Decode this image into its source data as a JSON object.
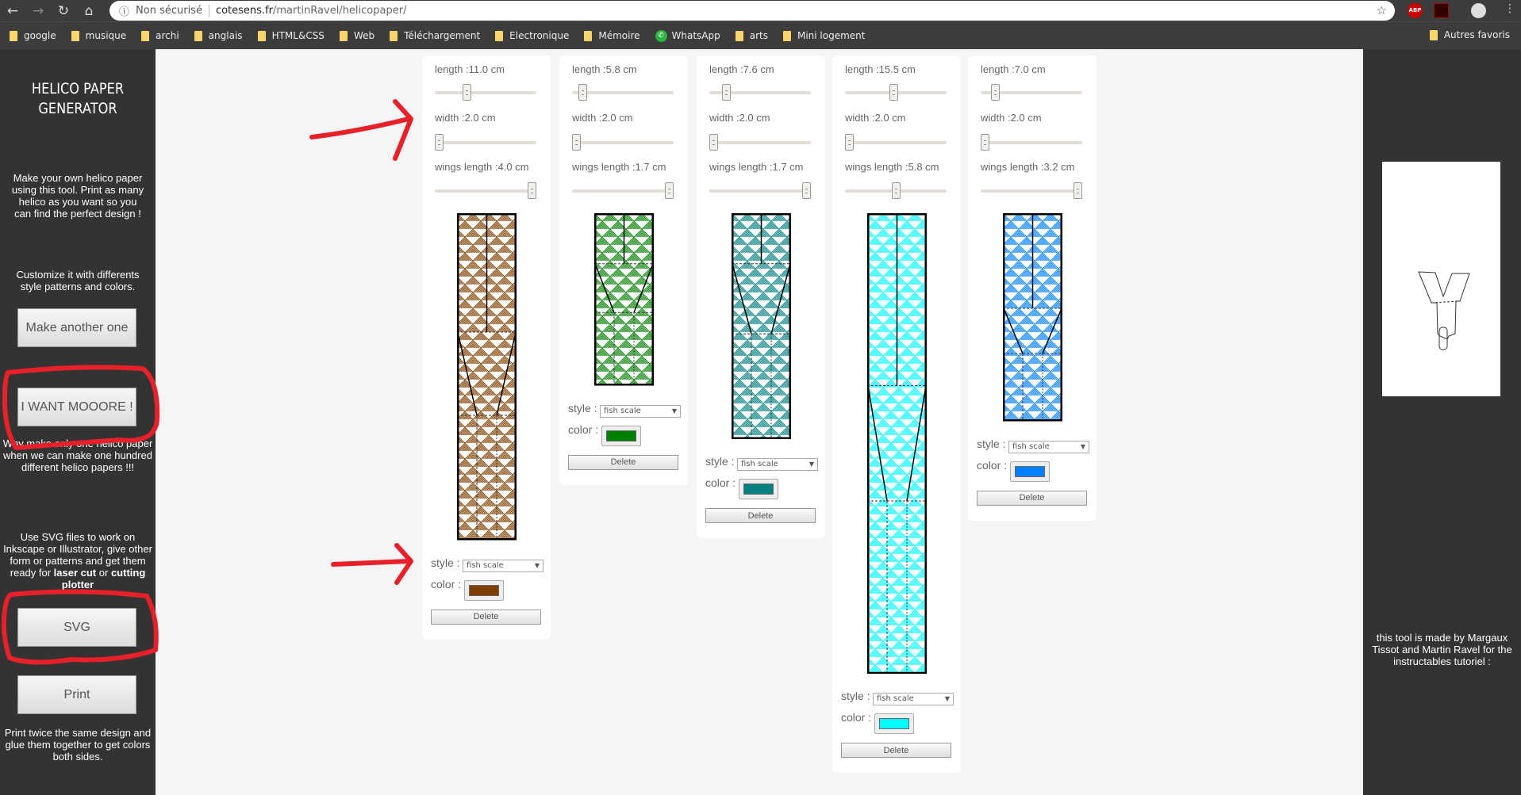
{
  "browser": {
    "security": "Non sécurisé",
    "url_host": "cotesens.fr",
    "url_path": "/martinRavel/helicopaper/",
    "bookmarks": [
      "google",
      "musique",
      "archi",
      "anglais",
      "HTML&CSS",
      "Web",
      "Téléchargement",
      "Electronique",
      "Mémoire",
      "WhatsApp",
      "arts",
      "Mini logement"
    ],
    "other_bookmarks": "Autres favoris",
    "ext_abp": "ABP"
  },
  "sidebar": {
    "title": "HELICO PAPER GENERATOR",
    "intro": "Make your own helico paper using this tool. Print as many helico as you want so you can find the perfect design !",
    "customize": "Customize it with differents style patterns and colors.",
    "make_another": "Make another one",
    "want_more": "I WANT MOOORE !",
    "more_text": "Why make only one helico paper when we can make one hundred different helico papers !!!",
    "svg_text_1": "Use SVG files to work on Inkscape or Illustrator, give other form or patterns and get them ready for ",
    "svg_bold_1": "laser cut",
    "svg_text_2": " or ",
    "svg_bold_2": "cutting plotter",
    "svg_button": "SVG",
    "print_button": "Print",
    "print_text": "Print twice the same design and glue them together to get colors both sides."
  },
  "right_panel": {
    "credit": "this tool is made by Margaux Tissot and Martin Ravel for the instructables tutoriel :"
  },
  "cards": [
    {
      "length_label": "length :11.0 cm",
      "width_label": "width :2.0 cm",
      "wings_label": "wings length :4.0 cm",
      "length": 11.0,
      "width": 2.0,
      "wings": 4.0,
      "length_slider": 0.3,
      "width_slider": 0,
      "wings_slider": 1,
      "style_label": "style :",
      "style": "fish scale",
      "color_label": "color :",
      "color": "#7f3f00",
      "delete": "Delete"
    },
    {
      "length_label": "length :5.8 cm",
      "width_label": "width :2.0 cm",
      "wings_label": "wings length :1.7 cm",
      "length": 5.8,
      "width": 2.0,
      "wings": 1.7,
      "length_slider": 0.07,
      "width_slider": 0,
      "wings_slider": 1,
      "style_label": "style :",
      "style": "fish scale",
      "color_label": "color :",
      "color": "#008000",
      "delete": "Delete"
    },
    {
      "length_label": "length :7.6 cm",
      "width_label": "width :2.0 cm",
      "wings_label": "wings length :1.7 cm",
      "length": 7.6,
      "width": 2.0,
      "wings": 1.7,
      "length_slider": 0.14,
      "width_slider": 0,
      "wings_slider": 1,
      "style_label": "style :",
      "style": "fish scale",
      "color_label": "color :",
      "color": "#008080",
      "delete": "Delete"
    },
    {
      "length_label": "length :15.5 cm",
      "width_label": "width :2.0 cm",
      "wings_label": "wings length :5.8 cm",
      "length": 15.5,
      "width": 2.0,
      "wings": 5.8,
      "length_slider": 0.48,
      "width_slider": 0,
      "wings_slider": 0.5,
      "style_label": "style :",
      "style": "fish scale",
      "color_label": "color :",
      "color": "#00ffff",
      "delete": "Delete"
    },
    {
      "length_label": "length :7.0 cm",
      "width_label": "width :2.0 cm",
      "wings_label": "wings length :3.2 cm",
      "length": 7.0,
      "width": 2.0,
      "wings": 3.2,
      "length_slider": 0.11,
      "width_slider": 0,
      "wings_slider": 1,
      "style_label": "style :",
      "style": "fish scale",
      "color_label": "color :",
      "color": "#0080ff",
      "delete": "Delete"
    }
  ],
  "annotation_color": "#e8202a"
}
